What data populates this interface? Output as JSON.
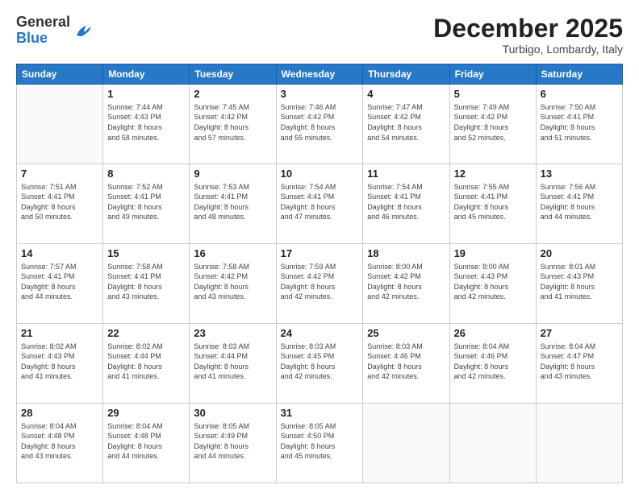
{
  "header": {
    "logo_general": "General",
    "logo_blue": "Blue",
    "month": "December 2025",
    "location": "Turbigo, Lombardy, Italy"
  },
  "weekdays": [
    "Sunday",
    "Monday",
    "Tuesday",
    "Wednesday",
    "Thursday",
    "Friday",
    "Saturday"
  ],
  "weeks": [
    [
      {
        "day": "",
        "sunrise": "",
        "sunset": "",
        "daylight": ""
      },
      {
        "day": "1",
        "sunrise": "Sunrise: 7:44 AM",
        "sunset": "Sunset: 4:43 PM",
        "daylight": "Daylight: 8 hours and 58 minutes."
      },
      {
        "day": "2",
        "sunrise": "Sunrise: 7:45 AM",
        "sunset": "Sunset: 4:42 PM",
        "daylight": "Daylight: 8 hours and 57 minutes."
      },
      {
        "day": "3",
        "sunrise": "Sunrise: 7:46 AM",
        "sunset": "Sunset: 4:42 PM",
        "daylight": "Daylight: 8 hours and 55 minutes."
      },
      {
        "day": "4",
        "sunrise": "Sunrise: 7:47 AM",
        "sunset": "Sunset: 4:42 PM",
        "daylight": "Daylight: 8 hours and 54 minutes."
      },
      {
        "day": "5",
        "sunrise": "Sunrise: 7:49 AM",
        "sunset": "Sunset: 4:42 PM",
        "daylight": "Daylight: 8 hours and 52 minutes."
      },
      {
        "day": "6",
        "sunrise": "Sunrise: 7:50 AM",
        "sunset": "Sunset: 4:41 PM",
        "daylight": "Daylight: 8 hours and 51 minutes."
      }
    ],
    [
      {
        "day": "7",
        "sunrise": "Sunrise: 7:51 AM",
        "sunset": "Sunset: 4:41 PM",
        "daylight": "Daylight: 8 hours and 50 minutes."
      },
      {
        "day": "8",
        "sunrise": "Sunrise: 7:52 AM",
        "sunset": "Sunset: 4:41 PM",
        "daylight": "Daylight: 8 hours and 49 minutes."
      },
      {
        "day": "9",
        "sunrise": "Sunrise: 7:53 AM",
        "sunset": "Sunset: 4:41 PM",
        "daylight": "Daylight: 8 hours and 48 minutes."
      },
      {
        "day": "10",
        "sunrise": "Sunrise: 7:54 AM",
        "sunset": "Sunset: 4:41 PM",
        "daylight": "Daylight: 8 hours and 47 minutes."
      },
      {
        "day": "11",
        "sunrise": "Sunrise: 7:54 AM",
        "sunset": "Sunset: 4:41 PM",
        "daylight": "Daylight: 8 hours and 46 minutes."
      },
      {
        "day": "12",
        "sunrise": "Sunrise: 7:55 AM",
        "sunset": "Sunset: 4:41 PM",
        "daylight": "Daylight: 8 hours and 45 minutes."
      },
      {
        "day": "13",
        "sunrise": "Sunrise: 7:56 AM",
        "sunset": "Sunset: 4:41 PM",
        "daylight": "Daylight: 8 hours and 44 minutes."
      }
    ],
    [
      {
        "day": "14",
        "sunrise": "Sunrise: 7:57 AM",
        "sunset": "Sunset: 4:41 PM",
        "daylight": "Daylight: 8 hours and 44 minutes."
      },
      {
        "day": "15",
        "sunrise": "Sunrise: 7:58 AM",
        "sunset": "Sunset: 4:41 PM",
        "daylight": "Daylight: 8 hours and 43 minutes."
      },
      {
        "day": "16",
        "sunrise": "Sunrise: 7:58 AM",
        "sunset": "Sunset: 4:42 PM",
        "daylight": "Daylight: 8 hours and 43 minutes."
      },
      {
        "day": "17",
        "sunrise": "Sunrise: 7:59 AM",
        "sunset": "Sunset: 4:42 PM",
        "daylight": "Daylight: 8 hours and 42 minutes."
      },
      {
        "day": "18",
        "sunrise": "Sunrise: 8:00 AM",
        "sunset": "Sunset: 4:42 PM",
        "daylight": "Daylight: 8 hours and 42 minutes."
      },
      {
        "day": "19",
        "sunrise": "Sunrise: 8:00 AM",
        "sunset": "Sunset: 4:43 PM",
        "daylight": "Daylight: 8 hours and 42 minutes."
      },
      {
        "day": "20",
        "sunrise": "Sunrise: 8:01 AM",
        "sunset": "Sunset: 4:43 PM",
        "daylight": "Daylight: 8 hours and 41 minutes."
      }
    ],
    [
      {
        "day": "21",
        "sunrise": "Sunrise: 8:02 AM",
        "sunset": "Sunset: 4:43 PM",
        "daylight": "Daylight: 8 hours and 41 minutes."
      },
      {
        "day": "22",
        "sunrise": "Sunrise: 8:02 AM",
        "sunset": "Sunset: 4:44 PM",
        "daylight": "Daylight: 8 hours and 41 minutes."
      },
      {
        "day": "23",
        "sunrise": "Sunrise: 8:03 AM",
        "sunset": "Sunset: 4:44 PM",
        "daylight": "Daylight: 8 hours and 41 minutes."
      },
      {
        "day": "24",
        "sunrise": "Sunrise: 8:03 AM",
        "sunset": "Sunset: 4:45 PM",
        "daylight": "Daylight: 8 hours and 42 minutes."
      },
      {
        "day": "25",
        "sunrise": "Sunrise: 8:03 AM",
        "sunset": "Sunset: 4:46 PM",
        "daylight": "Daylight: 8 hours and 42 minutes."
      },
      {
        "day": "26",
        "sunrise": "Sunrise: 8:04 AM",
        "sunset": "Sunset: 4:46 PM",
        "daylight": "Daylight: 8 hours and 42 minutes."
      },
      {
        "day": "27",
        "sunrise": "Sunrise: 8:04 AM",
        "sunset": "Sunset: 4:47 PM",
        "daylight": "Daylight: 8 hours and 43 minutes."
      }
    ],
    [
      {
        "day": "28",
        "sunrise": "Sunrise: 8:04 AM",
        "sunset": "Sunset: 4:48 PM",
        "daylight": "Daylight: 8 hours and 43 minutes."
      },
      {
        "day": "29",
        "sunrise": "Sunrise: 8:04 AM",
        "sunset": "Sunset: 4:48 PM",
        "daylight": "Daylight: 8 hours and 44 minutes."
      },
      {
        "day": "30",
        "sunrise": "Sunrise: 8:05 AM",
        "sunset": "Sunset: 4:49 PM",
        "daylight": "Daylight: 8 hours and 44 minutes."
      },
      {
        "day": "31",
        "sunrise": "Sunrise: 8:05 AM",
        "sunset": "Sunset: 4:50 PM",
        "daylight": "Daylight: 8 hours and 45 minutes."
      },
      {
        "day": "",
        "sunrise": "",
        "sunset": "",
        "daylight": ""
      },
      {
        "day": "",
        "sunrise": "",
        "sunset": "",
        "daylight": ""
      },
      {
        "day": "",
        "sunrise": "",
        "sunset": "",
        "daylight": ""
      }
    ]
  ]
}
